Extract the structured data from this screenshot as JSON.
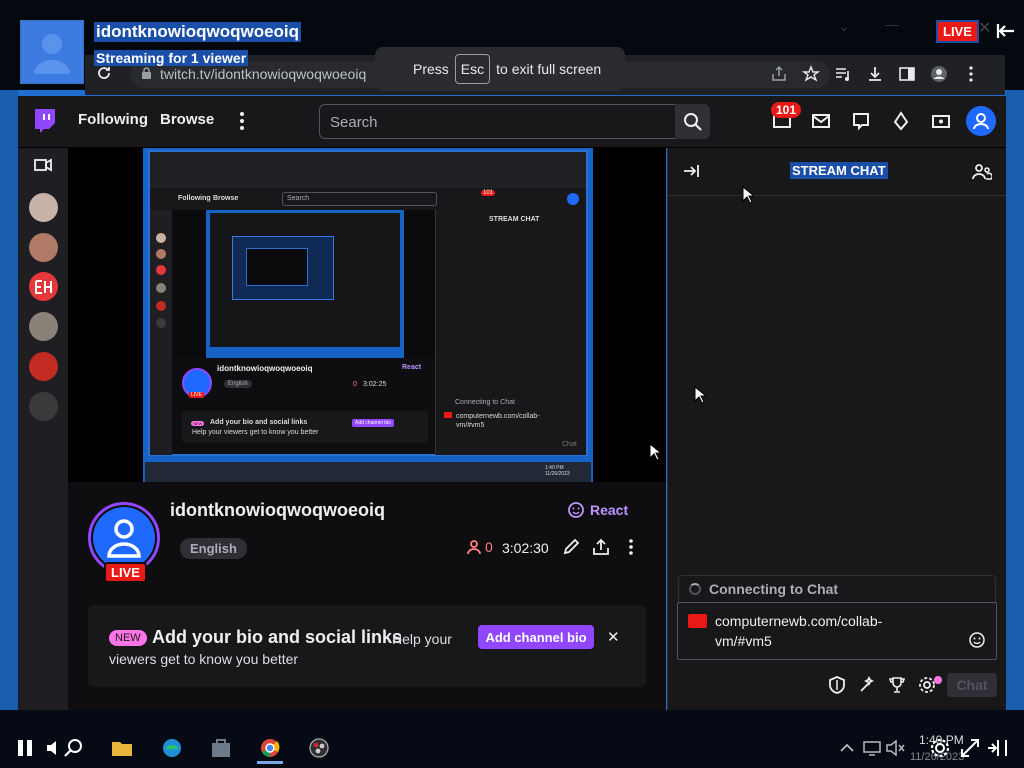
{
  "overlay": {
    "channel": "idontknowioqwoqwoeoiq",
    "status": "Streaming for 1 viewer",
    "live": "LIVE"
  },
  "browser": {
    "url": "twitch.tv/idontknowioqwoqwoeoiq",
    "fullscreen_tip": {
      "press": "Press",
      "key": "Esc",
      "rest": "to exit full screen"
    }
  },
  "twitch_nav": {
    "following": "Following",
    "browse": "Browse",
    "search_placeholder": "Search",
    "notifications_count": "101"
  },
  "inner_capture": {
    "following": "Following",
    "browse": "Browse",
    "search": "Search",
    "badge": "101",
    "stream_chat": "STREAM CHAT",
    "channel": "idontknowioqwoqwoeoiq",
    "lang": "English",
    "live": "LIVE",
    "react": "React",
    "uptime": "3:02:25",
    "viewers": "0",
    "new": "NEW",
    "bio_head": "Add your bio and social links",
    "bio_sub": "Help your viewers get to know you better",
    "bio_btn": "Add channel bio",
    "connecting": "Connecting to Chat",
    "msg": "computernewb.com/collab-vm/#vm5",
    "chat": "Chat",
    "time": "1:40 PM",
    "date": "11/26/2023"
  },
  "channel_info": {
    "name": "idontknowioqwoqwoeoiq",
    "language": "English",
    "live": "LIVE",
    "react": "React",
    "viewers": "0",
    "uptime": "3:02:30"
  },
  "bio_card": {
    "new": "NEW",
    "headline": "Add your bio and social links",
    "sub1": "Help your",
    "sub2": "viewers get to know you better",
    "button": "Add channel bio",
    "close": "✕"
  },
  "chat": {
    "title": "STREAM CHAT",
    "connecting": "Connecting to Chat",
    "input_text": "computernewb.com/collab-vm/#vm5",
    "send": "Chat"
  },
  "taskbar": {
    "time": "1:40 PM",
    "date": "11/26/2023"
  },
  "colors": {
    "twitch_purple": "#9147ff",
    "live_red": "#e91916",
    "desktop_blue": "#1f6fd0"
  }
}
